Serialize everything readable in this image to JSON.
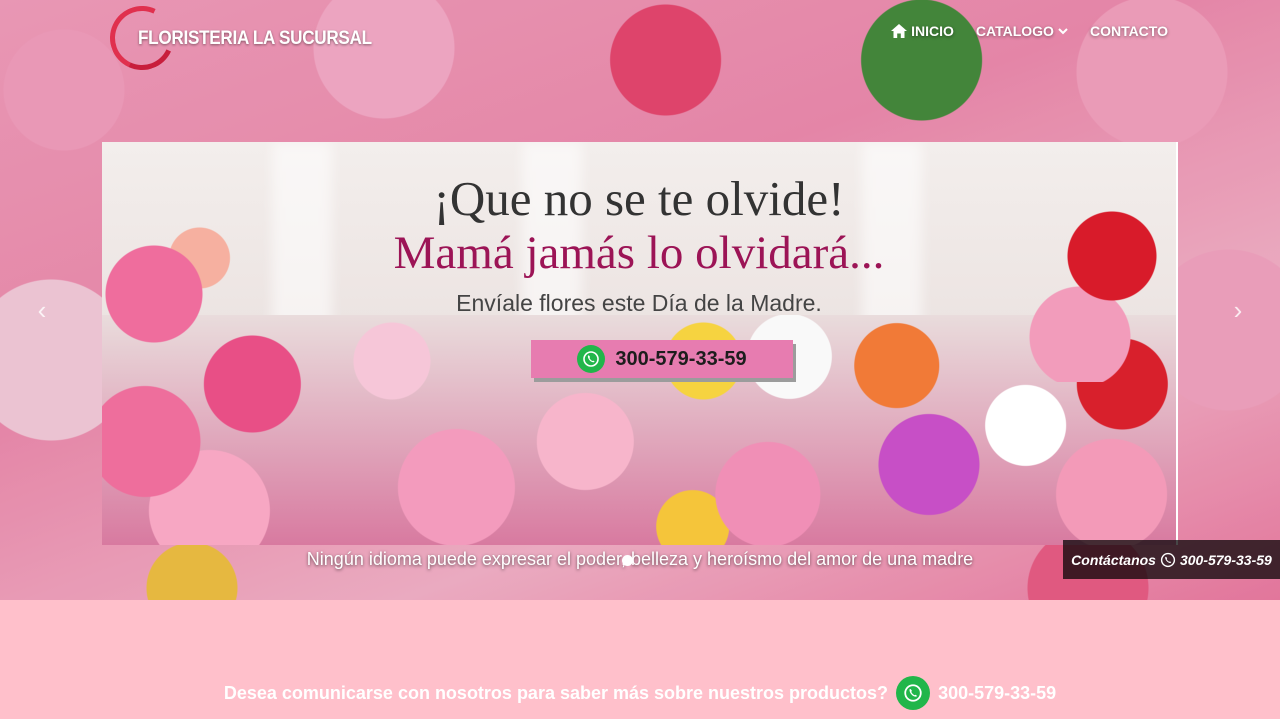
{
  "header": {
    "logo_text": "FLORISTERIA LA SUCURSAL",
    "nav": [
      {
        "label": "INICIO",
        "icon": "home-icon"
      },
      {
        "label": "CATALOGO",
        "icon": "chevron-down-icon"
      },
      {
        "label": "CONTACTO"
      }
    ]
  },
  "slider": {
    "banner": {
      "headline": "¡Que no se te olvide!",
      "subheadline": "Mamá jamás lo olvidará...",
      "line": "Envíale flores este Día de la Madre.",
      "phone": "300-579-33-59"
    },
    "caption": "Ningún idioma puede expresar el poder, belleza y heroísmo del amor de una madre",
    "prev_arrow": "‹",
    "next_arrow": "›"
  },
  "contact_tab": {
    "label": "Contáctanos",
    "phone": "300-579-33-59"
  },
  "cta": {
    "text": "Desea comunicarse con nosotros para saber más sobre nuestros productos?",
    "phone": "300-579-33-59"
  },
  "colors": {
    "page_background": "#ffc0cb",
    "whatsapp_green": "#21b64a",
    "banner_pink": "#e77cb0",
    "headline_magenta": "#9c1456"
  }
}
